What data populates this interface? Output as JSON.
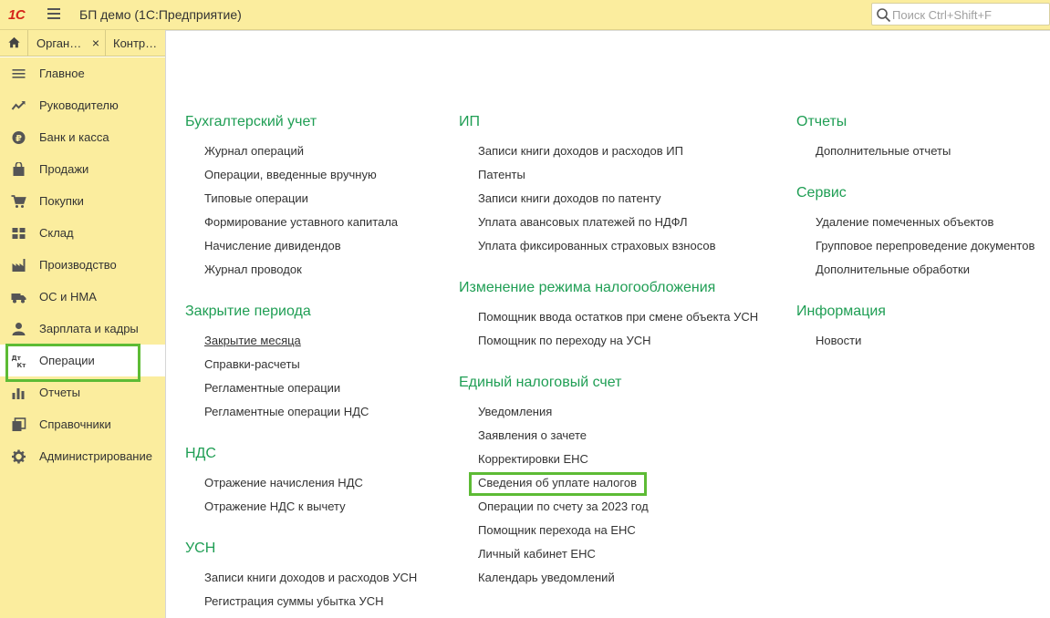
{
  "app": {
    "logo": "1С",
    "title": "БП демо  (1С:Предприятие)"
  },
  "search": {
    "placeholder": "Поиск Ctrl+Shift+F"
  },
  "tabs": [
    {
      "label": "Орган…"
    },
    {
      "label": "Контр…"
    }
  ],
  "sidebar": {
    "items": [
      {
        "label": "Главное",
        "icon": "list-icon"
      },
      {
        "label": "Руководителю",
        "icon": "trend-icon"
      },
      {
        "label": "Банк и касса",
        "icon": "ruble-icon"
      },
      {
        "label": "Продажи",
        "icon": "bag-icon"
      },
      {
        "label": "Покупки",
        "icon": "cart-icon"
      },
      {
        "label": "Склад",
        "icon": "warehouse-icon"
      },
      {
        "label": "Производство",
        "icon": "factory-icon"
      },
      {
        "label": "ОС и НМА",
        "icon": "truck-icon"
      },
      {
        "label": "Зарплата и кадры",
        "icon": "person-icon"
      },
      {
        "label": "Операции",
        "icon": "dt-kt-icon",
        "active": true
      },
      {
        "label": "Отчеты",
        "icon": "bar-chart-icon"
      },
      {
        "label": "Справочники",
        "icon": "books-icon"
      },
      {
        "label": "Администрирование",
        "icon": "gear-icon"
      }
    ]
  },
  "colors": {
    "accent_green": "#1f9e54",
    "highlight": "#5dbb35",
    "panel": "#fbed9e"
  },
  "sections": {
    "accounting": {
      "title": "Бухгалтерский учет",
      "links": [
        "Журнал операций",
        "Операции, введенные вручную",
        "Типовые операции",
        "Формирование уставного капитала",
        "Начисление дивидендов",
        "Журнал проводок"
      ]
    },
    "closing": {
      "title": "Закрытие периода",
      "links": [
        "Закрытие месяца",
        "Справки-расчеты",
        "Регламентные операции",
        "Регламентные операции НДС"
      ]
    },
    "vat": {
      "title": "НДС",
      "links": [
        "Отражение начисления НДС",
        "Отражение НДС к вычету"
      ]
    },
    "usn": {
      "title": "УСН",
      "links": [
        "Записи книги доходов и расходов УСН",
        "Регистрация суммы убытка УСН"
      ]
    },
    "ip": {
      "title": "ИП",
      "links": [
        "Записи книги доходов и расходов ИП",
        "Патенты",
        "Записи книги доходов по патенту",
        "Уплата авансовых платежей по НДФЛ",
        "Уплата фиксированных страховых взносов"
      ]
    },
    "tax_regime": {
      "title": "Изменение режима налогообложения",
      "links": [
        "Помощник ввода остатков при смене объекта УСН",
        "Помощник по переходу на УСН"
      ]
    },
    "ens": {
      "title": "Единый налоговый счет",
      "links": [
        "Уведомления",
        "Заявления о зачете",
        "Корректировки ЕНС",
        "Сведения об уплате налогов",
        "Операции по счету за 2023 год",
        "Помощник перехода на ЕНС",
        "Личный кабинет ЕНС",
        "Календарь уведомлений"
      ]
    },
    "reports": {
      "title": "Отчеты",
      "links": [
        "Дополнительные отчеты"
      ]
    },
    "service": {
      "title": "Сервис",
      "links": [
        "Удаление помеченных объектов",
        "Групповое перепроведение документов",
        "Дополнительные обработки"
      ]
    },
    "info": {
      "title": "Информация",
      "links": [
        "Новости"
      ]
    }
  }
}
